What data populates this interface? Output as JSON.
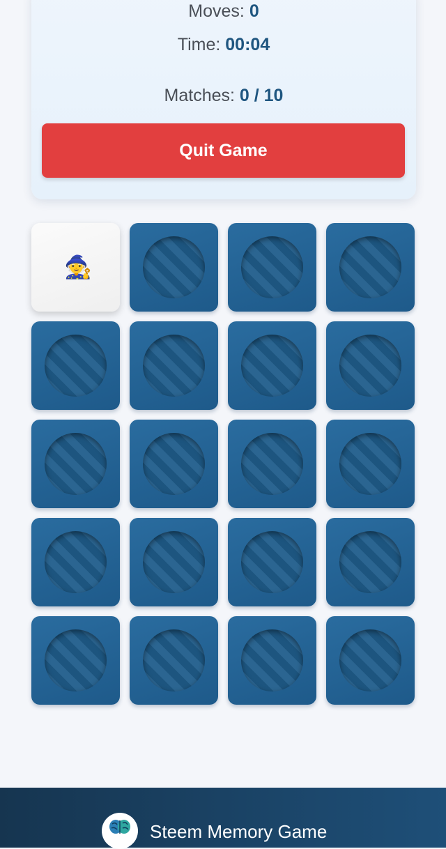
{
  "stats": {
    "moves_label": "Moves:",
    "moves_value": "0",
    "time_label": "Time:",
    "time_value": "00:04",
    "matches_label": "Matches:",
    "matches_value": "0 / 10"
  },
  "controls": {
    "quit_label": "Quit Game"
  },
  "board": {
    "rows": 5,
    "cols": 4,
    "cards": [
      {
        "state": "face-up",
        "icon": "gnome-icon",
        "glyph": "🧙"
      },
      {
        "state": "face-down"
      },
      {
        "state": "face-down"
      },
      {
        "state": "face-down"
      },
      {
        "state": "face-down"
      },
      {
        "state": "face-down"
      },
      {
        "state": "face-down"
      },
      {
        "state": "face-down"
      },
      {
        "state": "face-down"
      },
      {
        "state": "face-down"
      },
      {
        "state": "face-down"
      },
      {
        "state": "face-down"
      },
      {
        "state": "face-down"
      },
      {
        "state": "face-down"
      },
      {
        "state": "face-down"
      },
      {
        "state": "face-down"
      },
      {
        "state": "face-down"
      },
      {
        "state": "face-down"
      },
      {
        "state": "face-down"
      },
      {
        "state": "face-down"
      }
    ]
  },
  "footer": {
    "title": "Steem Memory Game",
    "logo_icon": "brain-icon"
  },
  "colors": {
    "accent": "#1f5680",
    "quit_button": "#e23f3f",
    "card_back": "#1e5a8a",
    "footer": "#163550"
  }
}
